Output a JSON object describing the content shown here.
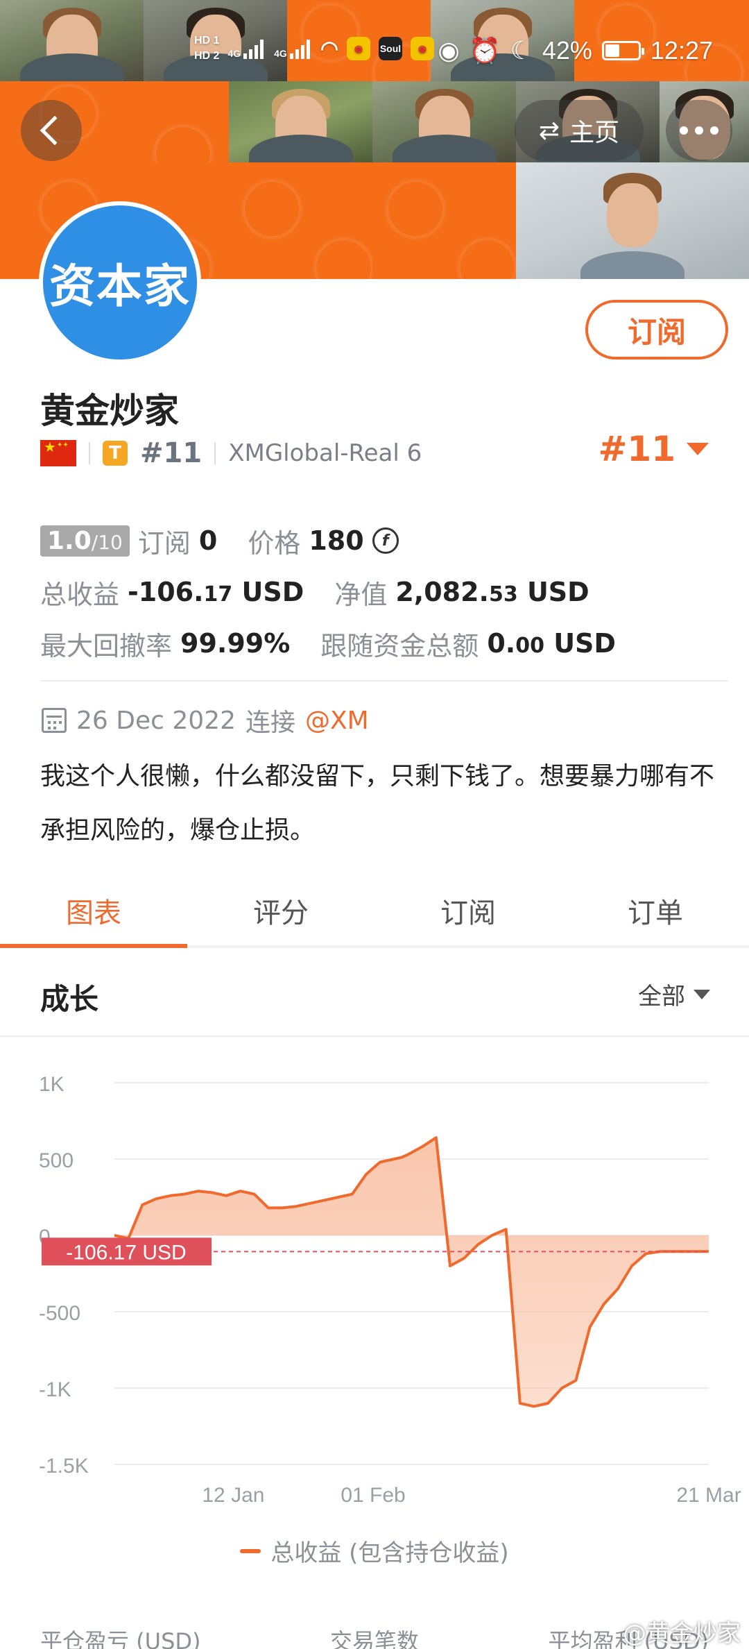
{
  "status_bar": {
    "hd1": "HD 1",
    "hd2": "HD 2",
    "net1": "4G",
    "net2": "4G",
    "soul_label": "Soul",
    "battery": "42%",
    "time": "12:27"
  },
  "header": {
    "home_label": "主页"
  },
  "profile": {
    "avatar_text": "资本家",
    "subscribe_label": "订阅",
    "name": "黄金炒家",
    "tier_badge": "T",
    "rank": "#11",
    "server": "XMGlobal-Real 6",
    "rank_highlight": "#11"
  },
  "stats": {
    "score_value": "1.0",
    "score_max": "/10",
    "subscribers_label": "订阅",
    "subscribers_value": "0",
    "price_label": "价格",
    "price_value": "180",
    "coin_symbol": "f",
    "total_profit_label": "总收益",
    "total_profit_main": "-106.",
    "total_profit_dec": "17",
    "total_profit_unit": "USD",
    "equity_label": "净值",
    "equity_main": "2,082.",
    "equity_dec": "53",
    "equity_unit": "USD",
    "drawdown_label": "最大回撤率",
    "drawdown_value": "99.99%",
    "follow_funds_label": "跟随资金总额",
    "follow_funds_main": "0.",
    "follow_funds_dec": "00",
    "follow_funds_unit": "USD"
  },
  "connection": {
    "date": "26 Dec 2022",
    "connect_label": "连接",
    "broker": "@XM"
  },
  "bio": "我这个人很懒，什么都没留下，只剩下钱了。想要暴力哪有不承担风险的，爆仓止损。",
  "tabs": [
    "图表",
    "评分",
    "订阅",
    "订单"
  ],
  "growth": {
    "title": "成长",
    "range": "全部"
  },
  "chart_data": {
    "type": "area",
    "title": "",
    "xlabel": "",
    "ylabel": "",
    "ylim": [
      -1500,
      1000
    ],
    "y_ticks": [
      "1K",
      "500",
      "0",
      "-500",
      "-1K",
      "-1.5K"
    ],
    "y_tick_values": [
      1000,
      500,
      0,
      -500,
      -1000,
      -1500
    ],
    "x_ticks": [
      "12 Jan",
      "01 Feb",
      "21 Mar"
    ],
    "x_range": [
      "2022-12-26",
      "2023-03-21"
    ],
    "x_tick_dates": [
      "2023-01-12",
      "2023-02-01",
      "2023-03-21"
    ],
    "current_value_label": "-106.17 USD",
    "current_value": -106.17,
    "legend": "总收益 (包含持仓收益)",
    "colors": {
      "line": "#ef6a2c",
      "fill": "#f9c3a8",
      "marker": "#e0505a"
    },
    "series": [
      {
        "name": "总收益 (包含持仓收益)",
        "x": [
          "2022-12-26",
          "2022-12-28",
          "2022-12-30",
          "2023-01-01",
          "2023-01-03",
          "2023-01-05",
          "2023-01-07",
          "2023-01-09",
          "2023-01-11",
          "2023-01-13",
          "2023-01-15",
          "2023-01-17",
          "2023-01-19",
          "2023-01-21",
          "2023-01-23",
          "2023-01-25",
          "2023-01-27",
          "2023-01-29",
          "2023-01-31",
          "2023-02-02",
          "2023-02-04",
          "2023-02-05",
          "2023-02-06",
          "2023-02-08",
          "2023-02-10",
          "2023-02-12",
          "2023-02-14",
          "2023-02-16",
          "2023-02-18",
          "2023-02-20",
          "2023-02-22",
          "2023-02-24",
          "2023-02-26",
          "2023-02-28",
          "2023-03-02",
          "2023-03-04",
          "2023-03-06",
          "2023-03-08",
          "2023-03-10",
          "2023-03-12",
          "2023-03-14",
          "2023-03-16",
          "2023-03-18",
          "2023-03-21"
        ],
        "values": [
          0,
          -20,
          200,
          240,
          260,
          270,
          290,
          280,
          260,
          290,
          270,
          180,
          180,
          190,
          210,
          230,
          250,
          270,
          400,
          480,
          500,
          510,
          530,
          580,
          640,
          -200,
          -150,
          -60,
          0,
          40,
          -1100,
          -1120,
          -1100,
          -1000,
          -950,
          -600,
          -450,
          -350,
          -200,
          -120,
          -106,
          -106,
          -106,
          -106
        ]
      }
    ]
  },
  "bottom_stats": {
    "closed_pnl_label": "平仓盈亏 (USD)",
    "trades_label": "交易笔数",
    "avg_profit_label": "平均盈利 (USD)"
  },
  "watermark": "@黄金炒家"
}
